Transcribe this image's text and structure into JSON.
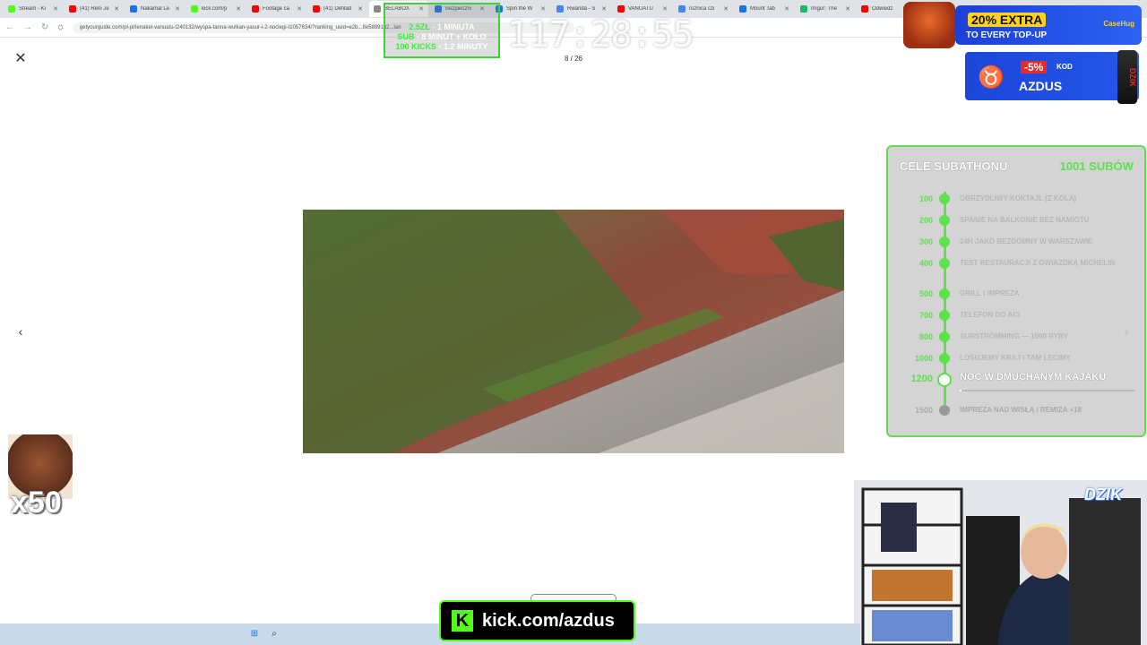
{
  "browser": {
    "tabs": [
      {
        "title": "Stream - Ki",
        "color": "#53fc18"
      },
      {
        "title": "(41) Reni Je",
        "color": "#ff0000"
      },
      {
        "title": "Nakamal Le",
        "color": "#1a73e8"
      },
      {
        "title": "kick.com/p",
        "color": "#53fc18"
      },
      {
        "title": "Footage ca",
        "color": "#ff0000"
      },
      {
        "title": "(41) Defilad",
        "color": "#ff0000"
      },
      {
        "title": "BELABOX",
        "color": "#888888"
      },
      {
        "title": "Bezpieczni",
        "color": "#1a73e8"
      },
      {
        "title": "Spin the W",
        "color": "#1a73e8"
      },
      {
        "title": "Rwanda - S",
        "color": "#4285f4"
      },
      {
        "title": "VANUATU",
        "color": "#ff0000"
      },
      {
        "title": "roznica czi",
        "color": "#4285f4"
      },
      {
        "title": "Mount Tab",
        "color": "#1a73e8"
      },
      {
        "title": "Imgur: The",
        "color": "#1bb76e"
      },
      {
        "title": "Odwiedz",
        "color": "#ff0000"
      }
    ],
    "url": "getyourguide.com/pl-pl/lenakel-vanuatu-l240132/wyspa-tanna-wulkan-yasur-i-2-noclegi-t1057634/?ranking_uuid=e2b...8e5899132...lan"
  },
  "gallery": {
    "counter": "8 / 26",
    "close_icon": "close-icon",
    "prev_icon": "chevron-left-icon",
    "next_icon": "chevron-right-icon"
  },
  "overlay": {
    "belabox": {
      "line1_a": "2.5ZŁ",
      "line1_b": " - 1 MINUTA",
      "line2_a": "SUB",
      "line2_b": " - 8 MINUT + KOŁO",
      "line3_a": "100 KICKS",
      "line3_b": " - 1.2 MINUTY"
    },
    "timer": "117:28:55",
    "promo_top": {
      "big": "20% EXTRA",
      "small": "TO EVERY TOP-UP",
      "brand": "CaseHug"
    },
    "promo_code": {
      "pct": "-5%",
      "kod": "KOD",
      "name": "AZDUS",
      "can": "DZIK"
    },
    "goals": {
      "title": "CELE SUBATHONU",
      "count": "1001 SUBÓW",
      "progress": 0.01,
      "items": [
        {
          "num": "100",
          "label": "OBRZYDLIWY KOKTAJL (Z KOLA)"
        },
        {
          "num": "200",
          "label": "SPANIE NA BALKONIE BEZ NAMIOTU"
        },
        {
          "num": "300",
          "label": "24H JAKO BEZDOMNY W WARSZAWIE"
        },
        {
          "num": "400",
          "label": "TEST RESTAURACJI Z GWIAZDKĄ MICHELIN"
        },
        {
          "num": "500",
          "label": "GRILL I IMPREZA"
        },
        {
          "num": "700",
          "label": "TELEFON DO ACI"
        },
        {
          "num": "800",
          "label": "SURSTRÖMMING — 1000 RYBY"
        },
        {
          "num": "1000",
          "label": "LOSUJEMY KRAJ I TAM LECIMY"
        },
        {
          "num": "1200",
          "label": "NOC W DMUCHANYM KAJAKU"
        },
        {
          "num": "1500",
          "label": "IMPREZA NAD WISŁĄ / REMIZA +18"
        }
      ]
    },
    "emote_combo": "x50",
    "webcam_logo": "DZIK",
    "kick_banner": "kick.com/azdus",
    "kick_logo": "K"
  },
  "colors": {
    "accent_green": "#5ee04f",
    "kick_green": "#53fc18"
  }
}
